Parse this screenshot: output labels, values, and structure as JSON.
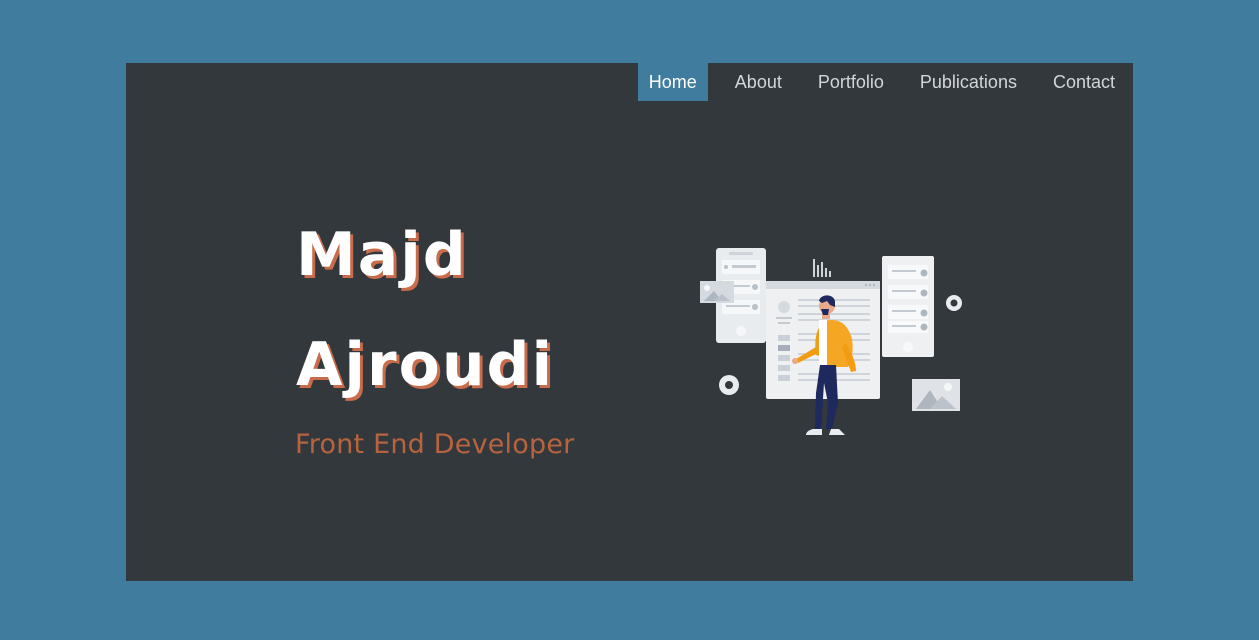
{
  "nav": {
    "items": [
      {
        "label": "Home",
        "active": true
      },
      {
        "label": "About",
        "active": false
      },
      {
        "label": "Portfolio",
        "active": false
      },
      {
        "label": "Publications",
        "active": false
      },
      {
        "label": "Contact",
        "active": false
      }
    ]
  },
  "hero": {
    "first_name": "Majd",
    "last_name": "Ajroudi",
    "role": "Front End Developer"
  },
  "colors": {
    "page_background": "#3f7c9e",
    "panel_background": "#32383c",
    "accent": "#c86c4b",
    "nav_active": "#3f7c9e",
    "figure_jacket": "#f39c12",
    "figure_pants": "#1e2a5e"
  }
}
